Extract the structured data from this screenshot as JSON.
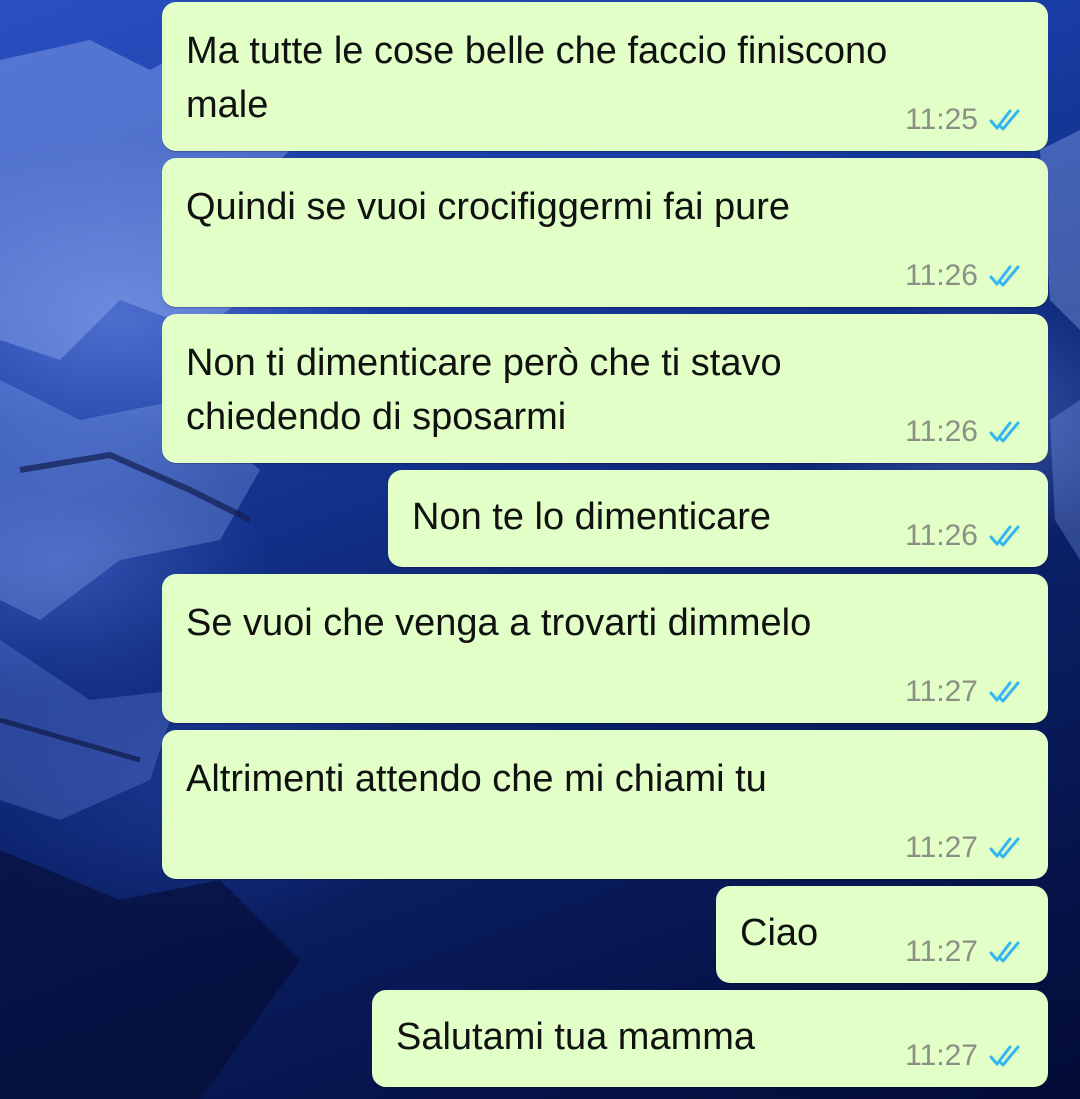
{
  "colors": {
    "bubble_background": "#e1ffc7",
    "timestamp": "#8b8f86",
    "read_ticks": "#34b7f1",
    "wallpaper": "#0a1a5c"
  },
  "messages": [
    {
      "text": "Ma tutte le cose belle che faccio finiscono\nmale",
      "time": "11:25",
      "status": "read-double-tick-icon"
    },
    {
      "text": "Quindi se vuoi crocifiggermi fai pure",
      "time": "11:26",
      "status": "read-double-tick-icon"
    },
    {
      "text": "Non ti dimenticare però che ti stavo\nchiedendo di sposarmi",
      "time": "11:26",
      "status": "read-double-tick-icon"
    },
    {
      "text": "Non te lo dimenticare",
      "time": "11:26",
      "status": "read-double-tick-icon"
    },
    {
      "text": "Se vuoi che venga a trovarti dimmelo",
      "time": "11:27",
      "status": "read-double-tick-icon"
    },
    {
      "text": "Altrimenti attendo che mi chiami tu",
      "time": "11:27",
      "status": "read-double-tick-icon"
    },
    {
      "text": "Ciao",
      "time": "11:27",
      "status": "read-double-tick-icon"
    },
    {
      "text": "Salutami tua mamma",
      "time": "11:27",
      "status": "read-double-tick-icon"
    }
  ]
}
